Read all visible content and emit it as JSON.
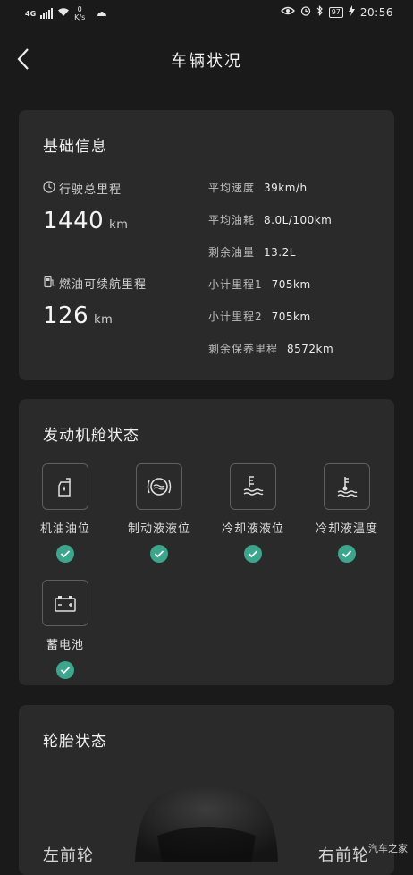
{
  "status_bar": {
    "net_type": "4G",
    "net_speed_value": "0",
    "net_speed_unit": "K/s",
    "battery": "97",
    "time": "20:56"
  },
  "header": {
    "title": "车辆状况"
  },
  "basic_info": {
    "title": "基础信息",
    "total_mileage_label": "行驶总里程",
    "total_mileage_value": "1440",
    "total_mileage_unit": "km",
    "range_label": "燃油可续航里程",
    "range_value": "126",
    "range_unit": "km",
    "stats": [
      {
        "label": "平均速度",
        "value": "39km/h"
      },
      {
        "label": "平均油耗",
        "value": "8.0L/100km"
      },
      {
        "label": "剩余油量",
        "value": "13.2L"
      },
      {
        "label": "小计里程1",
        "value": "705km"
      },
      {
        "label": "小计里程2",
        "value": "705km"
      },
      {
        "label": "剩余保养里程",
        "value": "8572km"
      }
    ]
  },
  "engine": {
    "title": "发动机舱状态",
    "items": [
      {
        "label": "机油油位",
        "icon": "oil-can-icon"
      },
      {
        "label": "制动液液位",
        "icon": "brake-fluid-icon"
      },
      {
        "label": "冷却液液位",
        "icon": "coolant-level-icon"
      },
      {
        "label": "冷却液温度",
        "icon": "coolant-temp-icon"
      },
      {
        "label": "蓄电池",
        "icon": "battery-icon"
      }
    ]
  },
  "tire": {
    "title": "轮胎状态",
    "front_left": "左前轮",
    "front_right": "右前轮"
  },
  "watermark": "汽车之家",
  "colors": {
    "background": "#1a1a1a",
    "card": "#2a2a2a",
    "ok_green": "#3aa78d"
  }
}
